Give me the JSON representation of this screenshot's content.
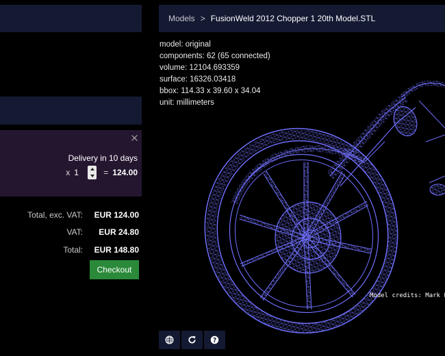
{
  "cart": {
    "delivery": "Delivery in 10 days",
    "quantity_prefix": "x",
    "quantity": "1",
    "equals": "=",
    "line_total": "124.00"
  },
  "totals": [
    {
      "label": "Total, exc. VAT:",
      "value": "EUR 124.00"
    },
    {
      "label": "VAT:",
      "value": "EUR 24.80"
    },
    {
      "label": "Total:",
      "value": "EUR 148.80"
    }
  ],
  "checkout_label": "Checkout",
  "breadcrumb": {
    "root": "Models",
    "separator": ">",
    "current": "FusionWeld 2012 Chopper 1 20th Model.STL"
  },
  "model_info": {
    "model": "model: original",
    "components": "components: 62 (65 connected)",
    "volume": "volume: 12104.693359",
    "surface": "surface: 16326.03418",
    "bbox": "bbox: 114.33 x 39.60 x 34.04",
    "unit": "unit: millimeters"
  },
  "credits": "Model credits: Mark Li",
  "toolbar": {
    "icons": [
      "globe-icon",
      "refresh-icon",
      "help-icon"
    ]
  },
  "colors": {
    "panel": "#151a33",
    "cart_bg": "#251630",
    "checkout": "#2a8a3a",
    "wire": "#6f6fff"
  }
}
